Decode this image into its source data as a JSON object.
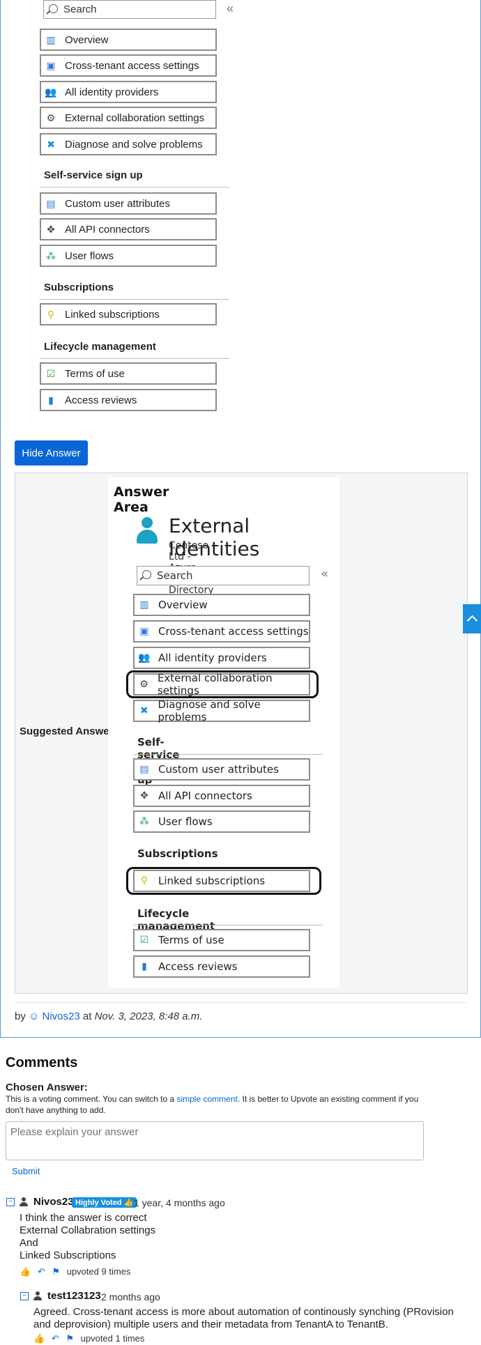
{
  "question_menu": {
    "search_placeholder": "Search",
    "collapse": "«",
    "items": [
      "Overview",
      "Cross-tenant access settings",
      "All identity providers",
      "External collaboration settings",
      "Diagnose and solve problems"
    ],
    "section_self_service": "Self-service sign up",
    "self_service_items": [
      "Custom user attributes",
      "All API connectors",
      "User flows"
    ],
    "section_subscriptions": "Subscriptions",
    "subscription_items": [
      "Linked subscriptions"
    ],
    "section_lifecycle": "Lifecycle management",
    "lifecycle_items": [
      "Terms of use",
      "Access reviews"
    ]
  },
  "hide_answer_label": "Hide Answer",
  "suggested_answer_label": "Suggested Answer:",
  "answer_area": {
    "heading": "Answer Area",
    "title": "External Identities",
    "subtitle": "Contoso Ltd - Azure Active Directory",
    "highlighted": [
      "External collaboration settings",
      "Linked subscriptions"
    ]
  },
  "byline": {
    "prefix": "by",
    "user": "Nivos23",
    "at": "at",
    "date": "Nov. 3, 2023, 8:48 a.m."
  },
  "comments": {
    "heading": "Comments",
    "chosen_label": "Chosen Answer:",
    "note_1": "This is a voting comment. You can switch to a",
    "note_link": "simple comment",
    "note_2": ". It is better to Upvote an existing comment if you don't have anything to add.",
    "textarea_placeholder": "Please explain your answer",
    "submit_label": "Submit",
    "list": [
      {
        "user": "Nivos23",
        "badge": "Highly Voted",
        "ago": "1 year, 4 months ago",
        "lines": [
          "I think the answer is correct",
          "External Collabration settings",
          "And",
          "Linked Subscriptions"
        ],
        "upvotes": "upvoted 9 times"
      },
      {
        "user": "test123123",
        "ago": "2 months ago",
        "lines": [
          "Agreed. Cross-tenant access is more about automation of continously synching (PRovision and deprovision) multiple users and their metadata from TenantA to TenantB."
        ],
        "upvotes": "upvoted 1 times"
      }
    ]
  },
  "colors": {
    "accent": "#0a66d6",
    "badge": "#1a8fe0",
    "answer_bg": "#f4f5f7"
  },
  "icons": [
    "search-icon",
    "overview-icon",
    "monitor-icon",
    "users-icon",
    "gear-icon",
    "wrench-icon",
    "card-icon",
    "connector-icon",
    "flow-icon",
    "key-icon",
    "check-doc-icon",
    "book-icon",
    "person-icon",
    "thumbs-up-icon",
    "reply-icon",
    "flag-icon",
    "collapse-icon",
    "scroll-up-icon"
  ]
}
